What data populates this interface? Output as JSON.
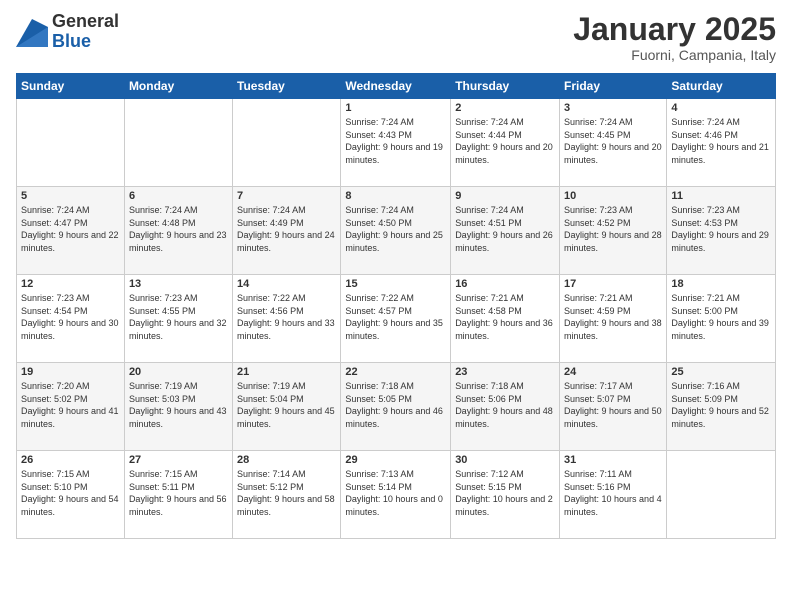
{
  "logo": {
    "general": "General",
    "blue": "Blue"
  },
  "header": {
    "month": "January 2025",
    "location": "Fuorni, Campania, Italy"
  },
  "days_header": [
    "Sunday",
    "Monday",
    "Tuesday",
    "Wednesday",
    "Thursday",
    "Friday",
    "Saturday"
  ],
  "weeks": [
    [
      {
        "day": "",
        "sunrise": "",
        "sunset": "",
        "daylight": ""
      },
      {
        "day": "",
        "sunrise": "",
        "sunset": "",
        "daylight": ""
      },
      {
        "day": "",
        "sunrise": "",
        "sunset": "",
        "daylight": ""
      },
      {
        "day": "1",
        "sunrise": "Sunrise: 7:24 AM",
        "sunset": "Sunset: 4:43 PM",
        "daylight": "Daylight: 9 hours and 19 minutes."
      },
      {
        "day": "2",
        "sunrise": "Sunrise: 7:24 AM",
        "sunset": "Sunset: 4:44 PM",
        "daylight": "Daylight: 9 hours and 20 minutes."
      },
      {
        "day": "3",
        "sunrise": "Sunrise: 7:24 AM",
        "sunset": "Sunset: 4:45 PM",
        "daylight": "Daylight: 9 hours and 20 minutes."
      },
      {
        "day": "4",
        "sunrise": "Sunrise: 7:24 AM",
        "sunset": "Sunset: 4:46 PM",
        "daylight": "Daylight: 9 hours and 21 minutes."
      }
    ],
    [
      {
        "day": "5",
        "sunrise": "Sunrise: 7:24 AM",
        "sunset": "Sunset: 4:47 PM",
        "daylight": "Daylight: 9 hours and 22 minutes."
      },
      {
        "day": "6",
        "sunrise": "Sunrise: 7:24 AM",
        "sunset": "Sunset: 4:48 PM",
        "daylight": "Daylight: 9 hours and 23 minutes."
      },
      {
        "day": "7",
        "sunrise": "Sunrise: 7:24 AM",
        "sunset": "Sunset: 4:49 PM",
        "daylight": "Daylight: 9 hours and 24 minutes."
      },
      {
        "day": "8",
        "sunrise": "Sunrise: 7:24 AM",
        "sunset": "Sunset: 4:50 PM",
        "daylight": "Daylight: 9 hours and 25 minutes."
      },
      {
        "day": "9",
        "sunrise": "Sunrise: 7:24 AM",
        "sunset": "Sunset: 4:51 PM",
        "daylight": "Daylight: 9 hours and 26 minutes."
      },
      {
        "day": "10",
        "sunrise": "Sunrise: 7:23 AM",
        "sunset": "Sunset: 4:52 PM",
        "daylight": "Daylight: 9 hours and 28 minutes."
      },
      {
        "day": "11",
        "sunrise": "Sunrise: 7:23 AM",
        "sunset": "Sunset: 4:53 PM",
        "daylight": "Daylight: 9 hours and 29 minutes."
      }
    ],
    [
      {
        "day": "12",
        "sunrise": "Sunrise: 7:23 AM",
        "sunset": "Sunset: 4:54 PM",
        "daylight": "Daylight: 9 hours and 30 minutes."
      },
      {
        "day": "13",
        "sunrise": "Sunrise: 7:23 AM",
        "sunset": "Sunset: 4:55 PM",
        "daylight": "Daylight: 9 hours and 32 minutes."
      },
      {
        "day": "14",
        "sunrise": "Sunrise: 7:22 AM",
        "sunset": "Sunset: 4:56 PM",
        "daylight": "Daylight: 9 hours and 33 minutes."
      },
      {
        "day": "15",
        "sunrise": "Sunrise: 7:22 AM",
        "sunset": "Sunset: 4:57 PM",
        "daylight": "Daylight: 9 hours and 35 minutes."
      },
      {
        "day": "16",
        "sunrise": "Sunrise: 7:21 AM",
        "sunset": "Sunset: 4:58 PM",
        "daylight": "Daylight: 9 hours and 36 minutes."
      },
      {
        "day": "17",
        "sunrise": "Sunrise: 7:21 AM",
        "sunset": "Sunset: 4:59 PM",
        "daylight": "Daylight: 9 hours and 38 minutes."
      },
      {
        "day": "18",
        "sunrise": "Sunrise: 7:21 AM",
        "sunset": "Sunset: 5:00 PM",
        "daylight": "Daylight: 9 hours and 39 minutes."
      }
    ],
    [
      {
        "day": "19",
        "sunrise": "Sunrise: 7:20 AM",
        "sunset": "Sunset: 5:02 PM",
        "daylight": "Daylight: 9 hours and 41 minutes."
      },
      {
        "day": "20",
        "sunrise": "Sunrise: 7:19 AM",
        "sunset": "Sunset: 5:03 PM",
        "daylight": "Daylight: 9 hours and 43 minutes."
      },
      {
        "day": "21",
        "sunrise": "Sunrise: 7:19 AM",
        "sunset": "Sunset: 5:04 PM",
        "daylight": "Daylight: 9 hours and 45 minutes."
      },
      {
        "day": "22",
        "sunrise": "Sunrise: 7:18 AM",
        "sunset": "Sunset: 5:05 PM",
        "daylight": "Daylight: 9 hours and 46 minutes."
      },
      {
        "day": "23",
        "sunrise": "Sunrise: 7:18 AM",
        "sunset": "Sunset: 5:06 PM",
        "daylight": "Daylight: 9 hours and 48 minutes."
      },
      {
        "day": "24",
        "sunrise": "Sunrise: 7:17 AM",
        "sunset": "Sunset: 5:07 PM",
        "daylight": "Daylight: 9 hours and 50 minutes."
      },
      {
        "day": "25",
        "sunrise": "Sunrise: 7:16 AM",
        "sunset": "Sunset: 5:09 PM",
        "daylight": "Daylight: 9 hours and 52 minutes."
      }
    ],
    [
      {
        "day": "26",
        "sunrise": "Sunrise: 7:15 AM",
        "sunset": "Sunset: 5:10 PM",
        "daylight": "Daylight: 9 hours and 54 minutes."
      },
      {
        "day": "27",
        "sunrise": "Sunrise: 7:15 AM",
        "sunset": "Sunset: 5:11 PM",
        "daylight": "Daylight: 9 hours and 56 minutes."
      },
      {
        "day": "28",
        "sunrise": "Sunrise: 7:14 AM",
        "sunset": "Sunset: 5:12 PM",
        "daylight": "Daylight: 9 hours and 58 minutes."
      },
      {
        "day": "29",
        "sunrise": "Sunrise: 7:13 AM",
        "sunset": "Sunset: 5:14 PM",
        "daylight": "Daylight: 10 hours and 0 minutes."
      },
      {
        "day": "30",
        "sunrise": "Sunrise: 7:12 AM",
        "sunset": "Sunset: 5:15 PM",
        "daylight": "Daylight: 10 hours and 2 minutes."
      },
      {
        "day": "31",
        "sunrise": "Sunrise: 7:11 AM",
        "sunset": "Sunset: 5:16 PM",
        "daylight": "Daylight: 10 hours and 4 minutes."
      },
      {
        "day": "",
        "sunrise": "",
        "sunset": "",
        "daylight": ""
      }
    ]
  ]
}
